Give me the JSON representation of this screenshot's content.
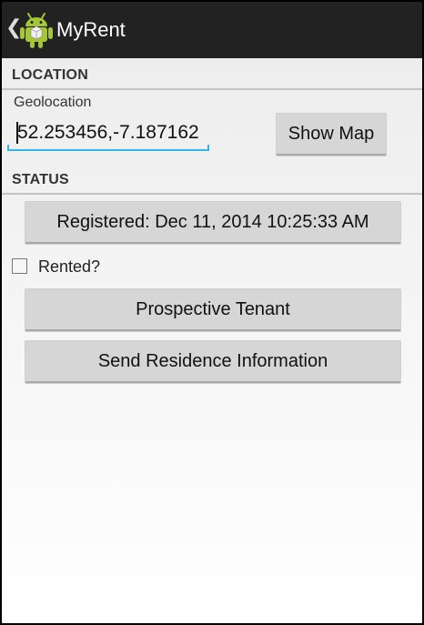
{
  "action_bar": {
    "title": "MyRent",
    "up_icon": "chevron-left-icon",
    "app_icon": "android-app-icon",
    "colors": {
      "background": "#222222",
      "title": "#ffffff"
    }
  },
  "location_section": {
    "header": "LOCATION",
    "geolocation_label": "Geolocation",
    "geolocation_value": "52.253456,-7.187162",
    "show_map_label": "Show Map"
  },
  "status_section": {
    "header": "STATUS",
    "registered_label": "Registered: Dec 11, 2014 10:25:33 AM",
    "rented_label": "Rented?",
    "rented_checked": false
  },
  "actions": {
    "prospective_tenant_label": "Prospective Tenant",
    "send_residence_label": "Send Residence Information"
  },
  "colors": {
    "accent": "#33b5e5",
    "button": "#d6d6d6"
  }
}
